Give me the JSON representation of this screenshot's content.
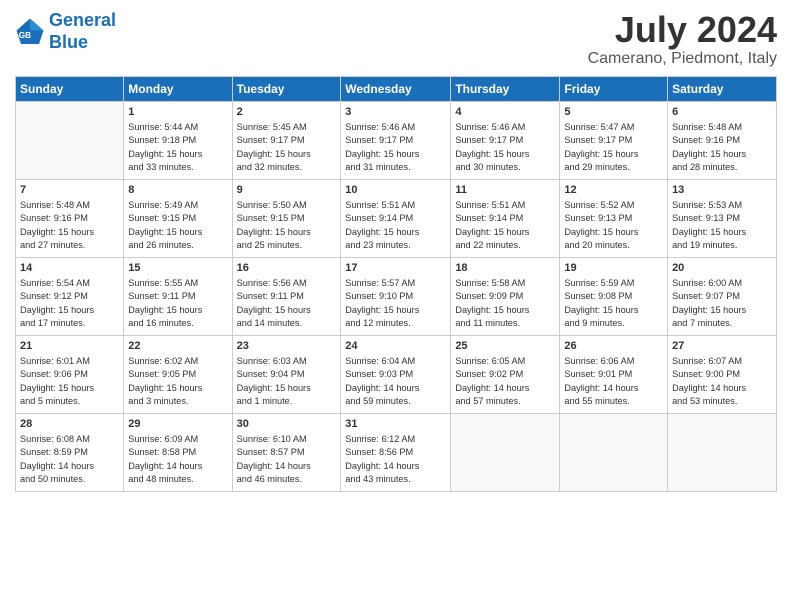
{
  "logo": {
    "line1": "General",
    "line2": "Blue"
  },
  "title": "July 2024",
  "location": "Camerano, Piedmont, Italy",
  "days_header": [
    "Sunday",
    "Monday",
    "Tuesday",
    "Wednesday",
    "Thursday",
    "Friday",
    "Saturday"
  ],
  "weeks": [
    [
      {
        "day": "",
        "content": ""
      },
      {
        "day": "1",
        "content": "Sunrise: 5:44 AM\nSunset: 9:18 PM\nDaylight: 15 hours\nand 33 minutes."
      },
      {
        "day": "2",
        "content": "Sunrise: 5:45 AM\nSunset: 9:17 PM\nDaylight: 15 hours\nand 32 minutes."
      },
      {
        "day": "3",
        "content": "Sunrise: 5:46 AM\nSunset: 9:17 PM\nDaylight: 15 hours\nand 31 minutes."
      },
      {
        "day": "4",
        "content": "Sunrise: 5:46 AM\nSunset: 9:17 PM\nDaylight: 15 hours\nand 30 minutes."
      },
      {
        "day": "5",
        "content": "Sunrise: 5:47 AM\nSunset: 9:17 PM\nDaylight: 15 hours\nand 29 minutes."
      },
      {
        "day": "6",
        "content": "Sunrise: 5:48 AM\nSunset: 9:16 PM\nDaylight: 15 hours\nand 28 minutes."
      }
    ],
    [
      {
        "day": "7",
        "content": "Sunrise: 5:48 AM\nSunset: 9:16 PM\nDaylight: 15 hours\nand 27 minutes."
      },
      {
        "day": "8",
        "content": "Sunrise: 5:49 AM\nSunset: 9:15 PM\nDaylight: 15 hours\nand 26 minutes."
      },
      {
        "day": "9",
        "content": "Sunrise: 5:50 AM\nSunset: 9:15 PM\nDaylight: 15 hours\nand 25 minutes."
      },
      {
        "day": "10",
        "content": "Sunrise: 5:51 AM\nSunset: 9:14 PM\nDaylight: 15 hours\nand 23 minutes."
      },
      {
        "day": "11",
        "content": "Sunrise: 5:51 AM\nSunset: 9:14 PM\nDaylight: 15 hours\nand 22 minutes."
      },
      {
        "day": "12",
        "content": "Sunrise: 5:52 AM\nSunset: 9:13 PM\nDaylight: 15 hours\nand 20 minutes."
      },
      {
        "day": "13",
        "content": "Sunrise: 5:53 AM\nSunset: 9:13 PM\nDaylight: 15 hours\nand 19 minutes."
      }
    ],
    [
      {
        "day": "14",
        "content": "Sunrise: 5:54 AM\nSunset: 9:12 PM\nDaylight: 15 hours\nand 17 minutes."
      },
      {
        "day": "15",
        "content": "Sunrise: 5:55 AM\nSunset: 9:11 PM\nDaylight: 15 hours\nand 16 minutes."
      },
      {
        "day": "16",
        "content": "Sunrise: 5:56 AM\nSunset: 9:11 PM\nDaylight: 15 hours\nand 14 minutes."
      },
      {
        "day": "17",
        "content": "Sunrise: 5:57 AM\nSunset: 9:10 PM\nDaylight: 15 hours\nand 12 minutes."
      },
      {
        "day": "18",
        "content": "Sunrise: 5:58 AM\nSunset: 9:09 PM\nDaylight: 15 hours\nand 11 minutes."
      },
      {
        "day": "19",
        "content": "Sunrise: 5:59 AM\nSunset: 9:08 PM\nDaylight: 15 hours\nand 9 minutes."
      },
      {
        "day": "20",
        "content": "Sunrise: 6:00 AM\nSunset: 9:07 PM\nDaylight: 15 hours\nand 7 minutes."
      }
    ],
    [
      {
        "day": "21",
        "content": "Sunrise: 6:01 AM\nSunset: 9:06 PM\nDaylight: 15 hours\nand 5 minutes."
      },
      {
        "day": "22",
        "content": "Sunrise: 6:02 AM\nSunset: 9:05 PM\nDaylight: 15 hours\nand 3 minutes."
      },
      {
        "day": "23",
        "content": "Sunrise: 6:03 AM\nSunset: 9:04 PM\nDaylight: 15 hours\nand 1 minute."
      },
      {
        "day": "24",
        "content": "Sunrise: 6:04 AM\nSunset: 9:03 PM\nDaylight: 14 hours\nand 59 minutes."
      },
      {
        "day": "25",
        "content": "Sunrise: 6:05 AM\nSunset: 9:02 PM\nDaylight: 14 hours\nand 57 minutes."
      },
      {
        "day": "26",
        "content": "Sunrise: 6:06 AM\nSunset: 9:01 PM\nDaylight: 14 hours\nand 55 minutes."
      },
      {
        "day": "27",
        "content": "Sunrise: 6:07 AM\nSunset: 9:00 PM\nDaylight: 14 hours\nand 53 minutes."
      }
    ],
    [
      {
        "day": "28",
        "content": "Sunrise: 6:08 AM\nSunset: 8:59 PM\nDaylight: 14 hours\nand 50 minutes."
      },
      {
        "day": "29",
        "content": "Sunrise: 6:09 AM\nSunset: 8:58 PM\nDaylight: 14 hours\nand 48 minutes."
      },
      {
        "day": "30",
        "content": "Sunrise: 6:10 AM\nSunset: 8:57 PM\nDaylight: 14 hours\nand 46 minutes."
      },
      {
        "day": "31",
        "content": "Sunrise: 6:12 AM\nSunset: 8:56 PM\nDaylight: 14 hours\nand 43 minutes."
      },
      {
        "day": "",
        "content": ""
      },
      {
        "day": "",
        "content": ""
      },
      {
        "day": "",
        "content": ""
      }
    ]
  ]
}
